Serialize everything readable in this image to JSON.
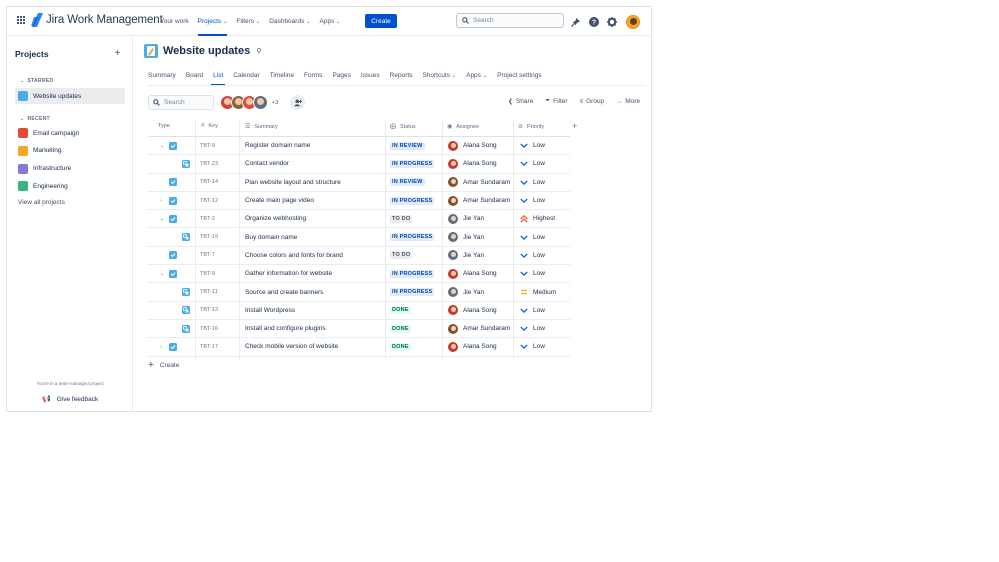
{
  "topnav": {
    "product": "Jira Work Management",
    "items": [
      {
        "label": "Your work",
        "chevron": false,
        "active": false
      },
      {
        "label": "Projects",
        "chevron": true,
        "active": true
      },
      {
        "label": "Filters",
        "chevron": true,
        "active": false
      },
      {
        "label": "Dashboards",
        "chevron": true,
        "active": false
      },
      {
        "label": "Apps",
        "chevron": true,
        "active": false
      }
    ],
    "create_label": "Create",
    "search_placeholder": "Search",
    "icons": [
      "notifications-icon",
      "help-icon",
      "settings-icon",
      "profile-avatar"
    ]
  },
  "sidebar": {
    "title": "Projects",
    "starred_label": "STARRED",
    "starred": [
      {
        "label": "Website updates",
        "color": "#4bade8"
      }
    ],
    "recent_label": "RECENT",
    "recent": [
      {
        "label": "Email campaign",
        "color": "#e5493a"
      },
      {
        "label": "Marketing",
        "color": "#f4a623"
      },
      {
        "label": "Infrastructure",
        "color": "#8777d9"
      },
      {
        "label": "Engineering",
        "color": "#36b37e"
      }
    ],
    "view_all": "View all projects",
    "footer_note": "You're in a team-managed project",
    "feedback": "Give feedback"
  },
  "project": {
    "name": "Website updates",
    "tabs": [
      {
        "label": "Summary",
        "chevron": false,
        "active": false
      },
      {
        "label": "Board",
        "chevron": false,
        "active": false
      },
      {
        "label": "List",
        "chevron": false,
        "active": true
      },
      {
        "label": "Calendar",
        "chevron": false,
        "active": false
      },
      {
        "label": "Timeline",
        "chevron": false,
        "active": false
      },
      {
        "label": "Forms",
        "chevron": false,
        "active": false
      },
      {
        "label": "Pages",
        "chevron": false,
        "active": false
      },
      {
        "label": "Issues",
        "chevron": false,
        "active": false
      },
      {
        "label": "Reports",
        "chevron": false,
        "active": false
      },
      {
        "label": "Shortcuts",
        "chevron": true,
        "active": false
      },
      {
        "label": "Apps",
        "chevron": true,
        "active": false
      },
      {
        "label": "Project settings",
        "chevron": false,
        "active": false
      }
    ]
  },
  "toolbar": {
    "search_placeholder": "Search",
    "avatar_colors": [
      "#d04437",
      "#8c6239",
      "#e5493a",
      "#5e6c84"
    ],
    "more_count": "+3",
    "share": "Share",
    "filter": "Filter",
    "group": "Group",
    "more": "More"
  },
  "columns": {
    "type": "Type",
    "key": "Key",
    "summary": "Summary",
    "status": "Status",
    "assignee": "Assignee",
    "priority": "Priority"
  },
  "rows": [
    {
      "expand": "down",
      "type": "task",
      "indent": 0,
      "key": "TBT-9",
      "summary": "Register domain name",
      "status": "IN REVIEW",
      "status_kind": "review",
      "assignee": "Alana Song",
      "assignee_color": "#c9372c",
      "priority": "Low",
      "priority_kind": "low"
    },
    {
      "expand": "",
      "type": "subtask",
      "indent": 1,
      "key": "TBT-23",
      "summary": "Contact vendor",
      "status": "IN PROGRESS",
      "status_kind": "progress",
      "assignee": "Alana Song",
      "assignee_color": "#c9372c",
      "priority": "Low",
      "priority_kind": "low"
    },
    {
      "expand": "",
      "type": "task",
      "indent": 0,
      "key": "TBT-14",
      "summary": "Plan website layout and structure",
      "status": "IN REVIEW",
      "status_kind": "review",
      "assignee": "Amar Sundaram",
      "assignee_color": "#7a5234",
      "priority": "Low",
      "priority_kind": "low"
    },
    {
      "expand": "right",
      "type": "task",
      "indent": 0,
      "key": "TBT-12",
      "summary": "Create main page video",
      "status": "IN PROGRESS",
      "status_kind": "progress",
      "assignee": "Amar Sundaram",
      "assignee_color": "#7a5234",
      "priority": "Low",
      "priority_kind": "low"
    },
    {
      "expand": "down",
      "type": "task",
      "indent": 0,
      "key": "TBT-2",
      "summary": "Organize webhosting",
      "status": "TO DO",
      "status_kind": "todo",
      "assignee": "Jie Yan",
      "assignee_color": "#5e6c84",
      "priority": "Highest",
      "priority_kind": "highest"
    },
    {
      "expand": "",
      "type": "subtask",
      "indent": 1,
      "key": "TBT-19",
      "summary": "Buy domain name",
      "status": "IN PROGRESS",
      "status_kind": "progress",
      "assignee": "Jie Yan",
      "assignee_color": "#5e6c84",
      "priority": "Low",
      "priority_kind": "low"
    },
    {
      "expand": "",
      "type": "task",
      "indent": 0,
      "key": "TBT-7",
      "summary": "Choose colors and fonts for brand",
      "status": "TO DO",
      "status_kind": "todo",
      "assignee": "Jie Yan",
      "assignee_color": "#5e6c84",
      "priority": "Low",
      "priority_kind": "low"
    },
    {
      "expand": "down",
      "type": "task",
      "indent": 0,
      "key": "TBT-9",
      "summary": "Gather information for website",
      "status": "IN PROGRESS",
      "status_kind": "progress",
      "assignee": "Alana Song",
      "assignee_color": "#c9372c",
      "priority": "Low",
      "priority_kind": "low"
    },
    {
      "expand": "",
      "type": "subtask",
      "indent": 1,
      "key": "TBT-11",
      "summary": "Source and create banners",
      "status": "IN PROGRESS",
      "status_kind": "progress",
      "assignee": "Jie Yan",
      "assignee_color": "#5e6c84",
      "priority": "Medium",
      "priority_kind": "medium"
    },
    {
      "expand": "",
      "type": "subtask",
      "indent": 1,
      "key": "TBT-13",
      "summary": "Install Wordpress",
      "status": "DONE",
      "status_kind": "done",
      "assignee": "Alana Song",
      "assignee_color": "#c9372c",
      "priority": "Low",
      "priority_kind": "low"
    },
    {
      "expand": "",
      "type": "subtask",
      "indent": 1,
      "key": "TBT-16",
      "summary": "Install and configure plugins",
      "status": "DONE",
      "status_kind": "done",
      "assignee": "Amar Sundaram",
      "assignee_color": "#7a5234",
      "priority": "Low",
      "priority_kind": "low"
    },
    {
      "expand": "right",
      "type": "task",
      "indent": 0,
      "key": "TBT-17",
      "summary": "Check mobile version of website",
      "status": "DONE",
      "status_kind": "done",
      "assignee": "Alana Song",
      "assignee_color": "#c9372c",
      "priority": "Low",
      "priority_kind": "low"
    }
  ],
  "create_label": "Create"
}
